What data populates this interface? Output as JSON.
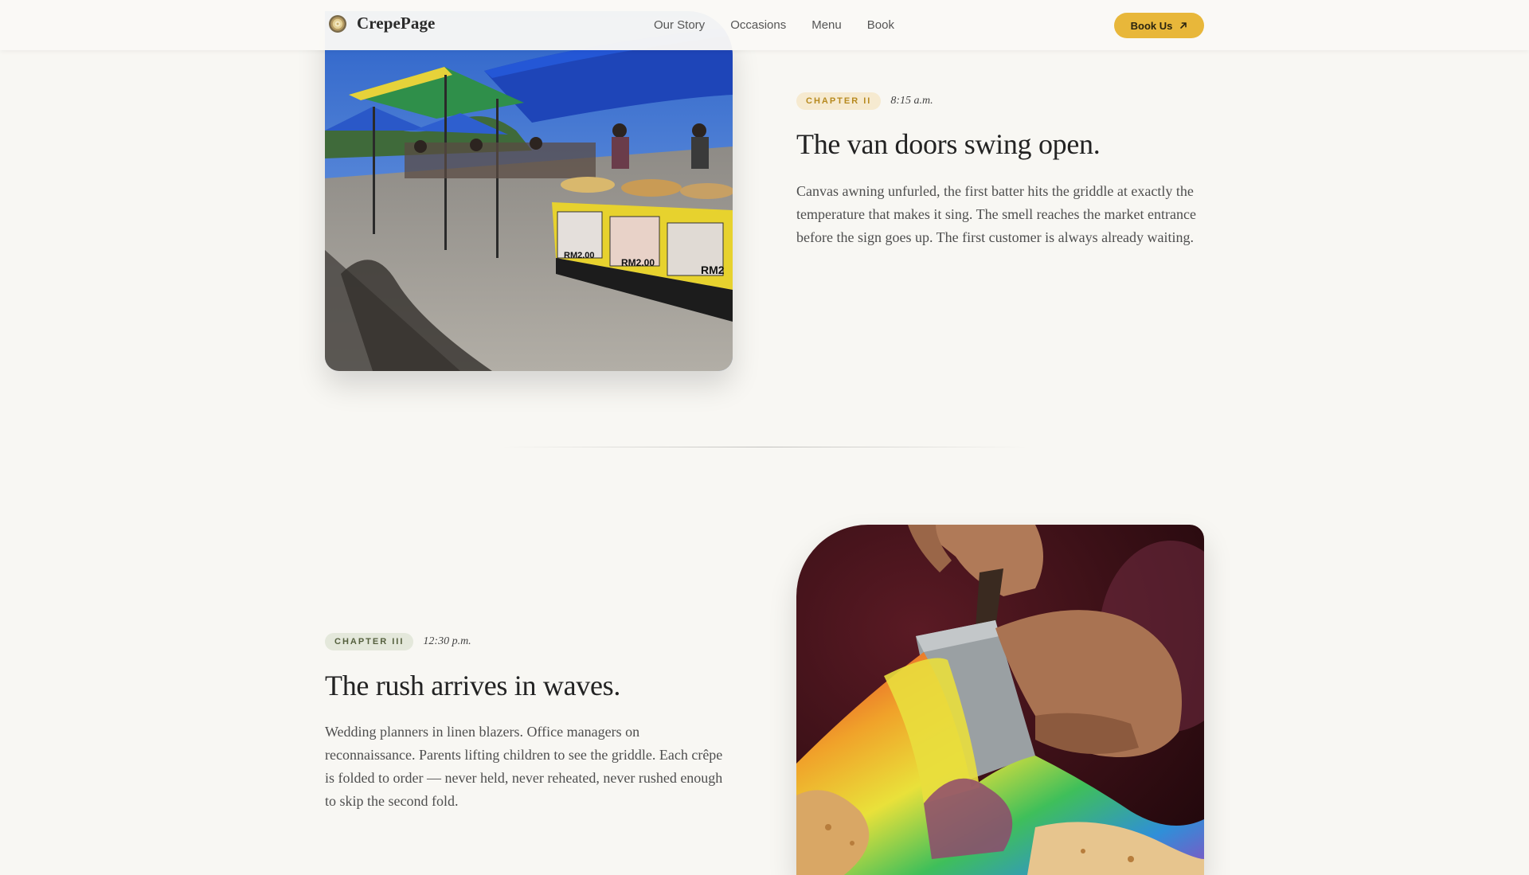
{
  "header": {
    "brand": "CrepePage",
    "nav": [
      "Our Story",
      "Occasions",
      "Menu",
      "Book"
    ],
    "cta_label": "Book Us"
  },
  "chapters": [
    {
      "badge": "CHAPTER II",
      "time": "8:15 a.m.",
      "title": "The van doors swing open.",
      "body": "Canvas awning unfurled, the first batter hits the griddle at exactly the temperature that makes it sing. The smell reaches the market entrance before the sign goes up. The first customer is always already waiting.",
      "photo_price_tags": [
        "RM2.00",
        "RM2.00",
        "RM2"
      ]
    },
    {
      "badge": "CHAPTER III",
      "time": "12:30 p.m.",
      "title": "The rush arrives in waves.",
      "body": "Wedding planners in linen blazers. Office managers on reconnaissance. Parents lifting children to see the griddle. Each crêpe is folded to order — never held, never reheated, never rushed enough to skip the second fold."
    }
  ],
  "colors": {
    "page_background": "#f8f7f3",
    "accent": "#e8b73a",
    "badge_gold_text": "#b78a1f",
    "badge_sage_text": "#55603e"
  },
  "icons": {
    "brand": "crepe-logo-icon",
    "cta": "arrow-up-right-icon"
  }
}
